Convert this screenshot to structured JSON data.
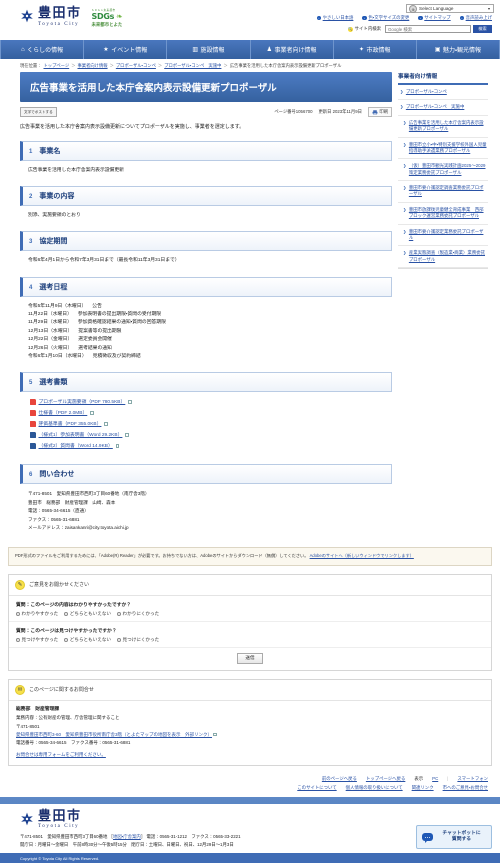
{
  "header": {
    "logo_jp": "豊田市",
    "logo_en": "Toyota City",
    "sdgs_top": "ＳＤＧｓ未来都市",
    "sdgs_logo": "SDGs",
    "sdgs_sub": "未来都市とよた",
    "language_select": "Select Language",
    "util_links": [
      {
        "label": "やさしい日本語",
        "icon": "circle-chevron-icon"
      },
      {
        "label": "色・文字サイズの変更",
        "icon": "circle-chevron-icon"
      },
      {
        "label": "サイトマップ",
        "icon": "circle-chevron-icon"
      },
      {
        "label": "音声読み上げ",
        "icon": "circle-chevron-icon"
      }
    ],
    "search_label": "サイト内検索",
    "search_placeholder": "Google 検索",
    "search_button": "検索"
  },
  "gnav": [
    {
      "label": "くらしの情報",
      "icon": "home-icon"
    },
    {
      "label": "イベント情報",
      "icon": "star-icon"
    },
    {
      "label": "施設情報",
      "icon": "building-icon"
    },
    {
      "label": "事業者向け情報",
      "icon": "briefcase-icon"
    },
    {
      "label": "市政情報",
      "icon": "city-icon"
    },
    {
      "label": "魅力・観光情報",
      "icon": "camera-icon"
    }
  ],
  "breadcrumb": {
    "prefix": "現在位置：",
    "items": [
      "トップページ",
      "事業者向け情報",
      "プロポーザル・コンペ",
      "プロポーザル・コンペ　実施中",
      "広告事業を活用した本庁舎案内表示設備更新プロポーザル"
    ],
    "separator": "＞"
  },
  "page": {
    "title": "広告事業を活用した本庁舎案内表示設備更新プロポーザル",
    "post_button": "文字でポストする",
    "page_number": "ページ番号1056700",
    "updated": "更新日 2023年11月9日",
    "print_label": "印刷",
    "intro": "広告事業を活用した本庁舎案内表示設備更新についてプロポーザルを実施し、事業者を選定します。"
  },
  "sections": [
    {
      "num": "1",
      "title": "事業名",
      "body": "広告事業を活用した本庁舎案内表示設備更新"
    },
    {
      "num": "2",
      "title": "事業の内容",
      "body": "別添、実施要領のとおり"
    },
    {
      "num": "3",
      "title": "協定期間",
      "body": "令和6年4月1日から令和7年3月31日まで（最長令和11年3月31日まで）"
    }
  ],
  "schedule": {
    "num": "4",
    "title": "選考日程",
    "rows": [
      {
        "date": "令和5年11月9日（木曜日）",
        "event": "公告"
      },
      {
        "date": "11月22日（水曜日）",
        "event": "参加表明書の提出期限・質問の受付期限"
      },
      {
        "date": "11月29日（水曜日）",
        "event": "参加資格確認結果の通知・質問の回答期限"
      },
      {
        "date": "12月13日（水曜日）",
        "event": "提案書等の提出期限"
      },
      {
        "date": "12月22日（金曜日）",
        "event": "選定委員会開催"
      },
      {
        "date": "12月26日（火曜日）",
        "event": "選考結果の通知"
      },
      {
        "date": "令和6年1月10日（水曜日）",
        "event": "見積徴収及び契約締結"
      }
    ]
  },
  "documents": {
    "num": "5",
    "title": "選考書類",
    "items": [
      {
        "label": "プロポーザル実施要領（PDF 780.5KB）",
        "type": "pdf",
        "icon": "pdf-icon"
      },
      {
        "label": "仕様書（PDF 2.0MB）",
        "type": "pdf",
        "icon": "pdf-icon"
      },
      {
        "label": "評価基準書（PDF 355.0KB）",
        "type": "pdf",
        "icon": "pdf-icon"
      },
      {
        "label": "（様式1）参加表明書（Word 29.2KB）",
        "type": "word",
        "icon": "word-icon"
      },
      {
        "label": "（様式2）質問書（Word 14.9KB）",
        "type": "word",
        "icon": "word-icon"
      }
    ]
  },
  "contact_section": {
    "num": "6",
    "title": "問い合わせ",
    "lines": [
      "〒471-8501　愛知県豊田市西町3丁目60番地（南庁舎3階）",
      "豊田市　総務部　財産管理課　山崎、森本",
      "電話：0565-34-6615（直通）",
      "ファクス：0565-31-6881",
      "メールアドレス：zaisankanri@city.toyota.aichi.jp"
    ]
  },
  "pdf_notice": {
    "text": "PDF形式のファイルをご利用するためには、「Adobe(R) Reader」が必要です。お持ちでない方は、Adobeのサイトからダウンロード（無償）してください。",
    "link": "Adobeのサイトへ（新しいウィンドウでリンクします）"
  },
  "survey": {
    "heading": "ご意見をお聞かせください",
    "icon": "pencil-icon",
    "questions": [
      {
        "text": "質問：このページの内容はわかりやすかったですか？",
        "options": [
          "わかりやすかった",
          "どちらともいえない",
          "わかりにくかった"
        ]
      },
      {
        "text": "質問：このページは見つけやすかったですか？",
        "options": [
          "見つけやすかった",
          "どちらともいえない",
          "見つけにくかった"
        ]
      }
    ],
    "submit": "送信"
  },
  "page_contact": {
    "heading": "このページに関するお問合せ",
    "icon": "mail-icon",
    "dept": "総務部　財産管理課",
    "duties": "業務内容：公有財産の管理、庁舎管理に関すること",
    "postal": "〒471-8501",
    "address_link": "愛知県豊田市西町3-60　愛知県豊田市役所南庁舎3階（とよたマップの地図を表示　外部リンク）",
    "phone": "電話番号：0565-34-6615　ファクス番号：0565-31-6881",
    "form_link": "お問合せは専用フォームをご利用ください。"
  },
  "bottom_nav": {
    "row1": [
      {
        "label": "前のページへ戻る",
        "type": "link"
      },
      {
        "label": "トップページへ戻る",
        "type": "link"
      },
      {
        "label": "表示",
        "type": "text"
      },
      {
        "label": "PC",
        "type": "link"
      },
      {
        "label": "スマートフォン",
        "type": "link"
      }
    ],
    "row2": [
      {
        "label": "このサイトについて",
        "type": "link"
      },
      {
        "label": "個人情報の取り扱いについて",
        "type": "link"
      },
      {
        "label": "関連リンク",
        "type": "link"
      },
      {
        "label": "市へのご意見・お問合せ",
        "type": "link"
      }
    ]
  },
  "footer": {
    "logo_jp": "豊田市",
    "logo_en": "Toyota City",
    "address": "〒471-8501　愛知県豊田市西町3丁目60番地",
    "map_link": "地図・庁舎案内",
    "phone": "電話：0565-31-1212　ファクス：0565-33-2221",
    "hours": "開庁日：月曜日～金曜日　午前8時30分～午後5時15分　閉庁日：土曜日、日曜日、祝日、12月29日～1月3日",
    "copyright": "Copyright © Toyota City All Rights Reserved."
  },
  "chatbot": {
    "line1": "チャットボットに",
    "line2": "質問する",
    "icon": "chat-bubble-icon"
  },
  "sidebar": {
    "title": "事業者向け情報",
    "items": [
      {
        "label": "プロポーザル・コンペ",
        "level": 1
      },
      {
        "label": "プロポーザル・コンペ　実施中",
        "level": 1
      },
      {
        "label": "広告事業を活用した本庁舎案内表示設備更新プロポーザル",
        "level": 2
      },
      {
        "label": "豊田市立小・中・特別支援学校外国人児童指導助手派遣業務プロポーザル",
        "level": 2
      },
      {
        "label": "（仮）豊田市観光実践計画2025～2029策定業務委託プロポーザル",
        "level": 2
      },
      {
        "label": "豊田市要介護認定調査業務委託プロポーザル",
        "level": 2
      },
      {
        "label": "豊田市放課後児童健全育成事業　西部ブロック運営業務委託プロポーザル",
        "level": 2
      },
      {
        "label": "豊田市要介護認定業務委託プロポーザル",
        "level": 2
      },
      {
        "label": "産業実態調査（製造業・商業）業務委託プロポーザル",
        "level": 2
      }
    ]
  }
}
